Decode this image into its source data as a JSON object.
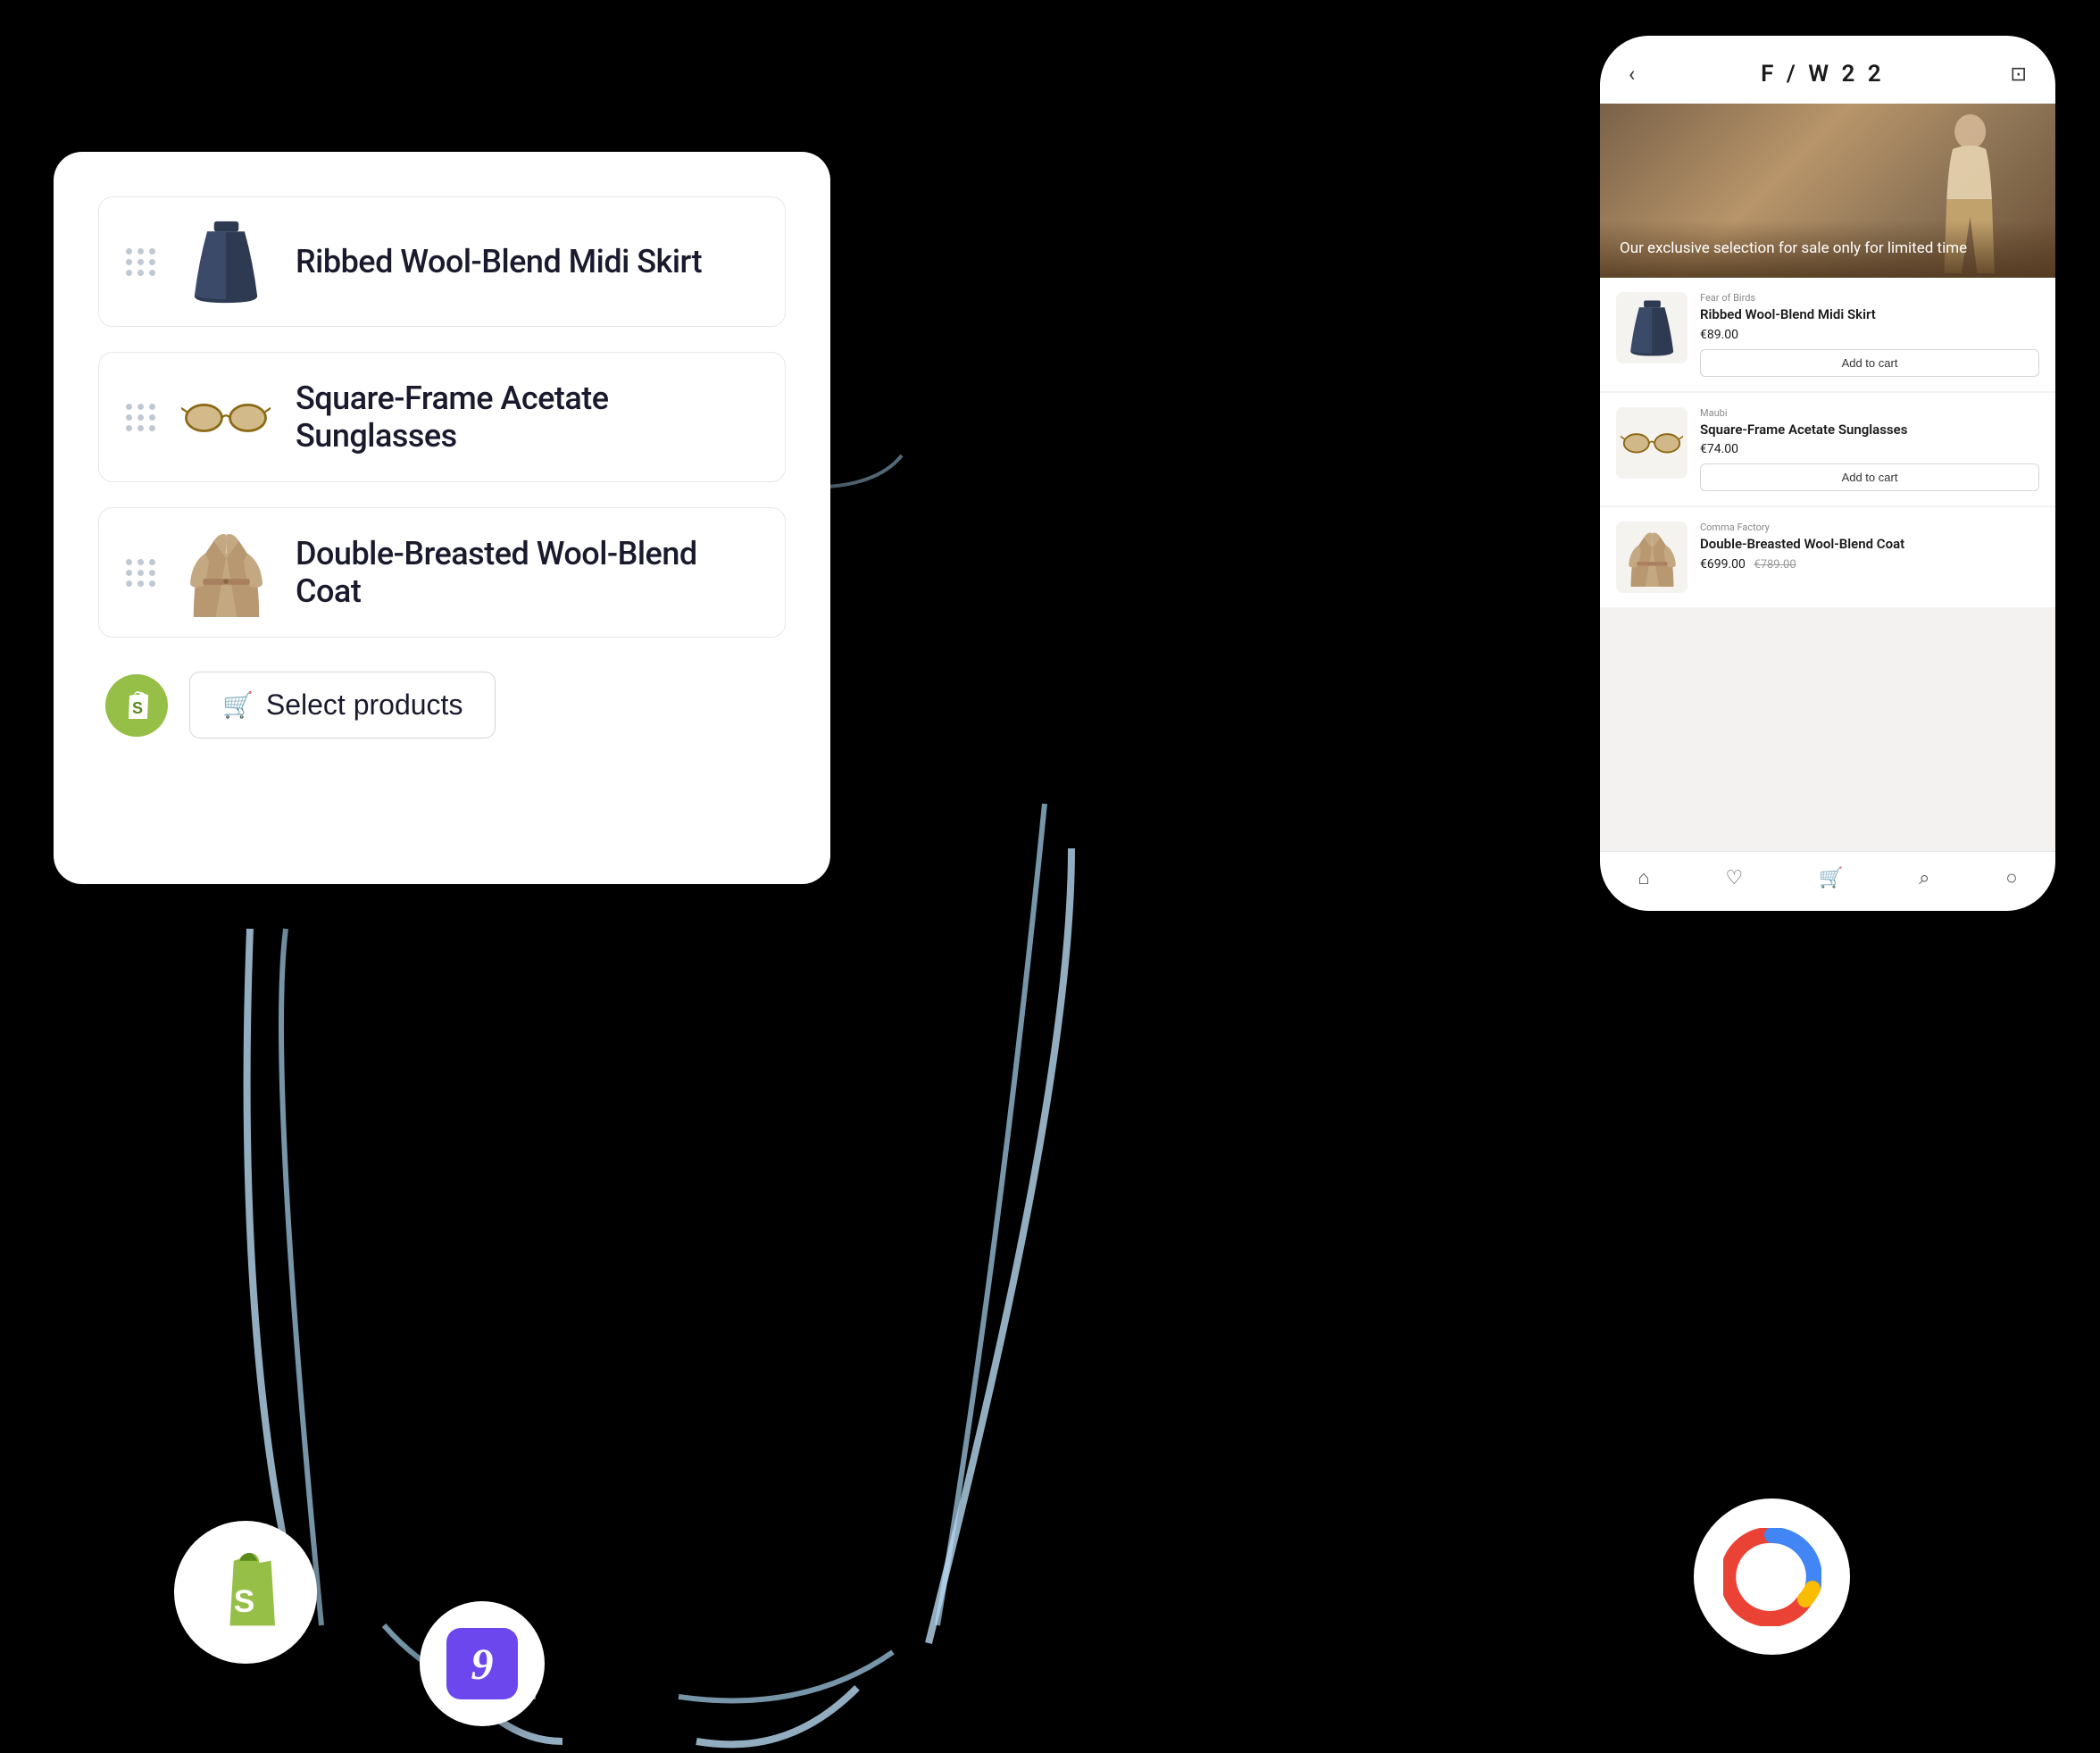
{
  "scene": {
    "background": "#000000"
  },
  "adminPanel": {
    "products": [
      {
        "id": "skirt",
        "name": "Ribbed Wool-Blend Midi Skirt",
        "imageType": "skirt"
      },
      {
        "id": "sunglasses",
        "name": "Square-Frame Acetate Sunglasses",
        "imageType": "sunglasses"
      },
      {
        "id": "coat",
        "name": "Double-Breasted Wool-Blend Coat",
        "imageType": "coat"
      }
    ],
    "selectButtonLabel": "Select products"
  },
  "phoneMockup": {
    "header": {
      "title": "F / W  2 2",
      "backIcon": "‹",
      "cartIcon": "⊡"
    },
    "hero": {
      "text": "Our exclusive selection for sale only for limited time"
    },
    "products": [
      {
        "id": "skirt",
        "brand": "Fear of Birds",
        "name": "Ribbed Wool-Blend Midi Skirt",
        "price": "€89.00",
        "priceStrike": null,
        "addToCart": "Add to cart"
      },
      {
        "id": "sunglasses",
        "brand": "Maubi",
        "name": "Square-Frame Acetate Sunglasses",
        "price": "€74.00",
        "priceStrike": null,
        "addToCart": "Add to cart"
      },
      {
        "id": "coat",
        "brand": "Comma Factory",
        "name": "Double-Breasted Wool-Blend Coat",
        "price": "€699.00",
        "priceStrike": "€789.00",
        "addToCart": null
      }
    ],
    "bottomNav": [
      "home",
      "heart",
      "cart",
      "search",
      "user"
    ]
  },
  "circles": {
    "shopify": {
      "label": "Shopify"
    },
    "typeform": {
      "label": "Typeform",
      "symbol": "9"
    },
    "google": {
      "label": "Google"
    }
  }
}
